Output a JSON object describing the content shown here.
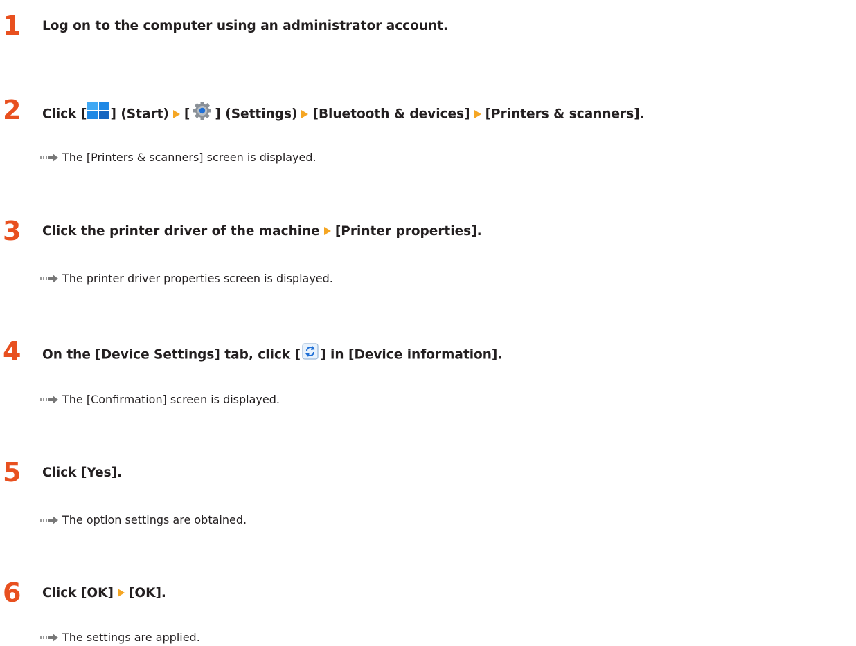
{
  "steps": [
    {
      "number": "1",
      "text": "Log on to the computer using an administrator account."
    },
    {
      "number": "2",
      "parts": {
        "click": "Click [",
        "start_close": "] (Start)",
        "settings_open": "[",
        "settings_close": "] (Settings)",
        "bluetooth": "[Bluetooth & devices]",
        "printers": "[Printers & scanners]."
      },
      "icons": [
        "windows-start-icon",
        "settings-gear-icon"
      ],
      "result": "The [Printers & scanners] screen is displayed."
    },
    {
      "number": "3",
      "parts": {
        "first": "Click the printer driver of the machine",
        "second": "[Printer properties]."
      },
      "result": "The printer driver properties screen is displayed."
    },
    {
      "number": "4",
      "parts": {
        "before": "On the [Device Settings] tab, click [",
        "after": "] in [Device information]."
      },
      "icons": [
        "refresh-icon"
      ],
      "result": "The [Confirmation] screen is displayed."
    },
    {
      "number": "5",
      "text": "Click [Yes].",
      "result": "The option settings are obtained."
    },
    {
      "number": "6",
      "parts": {
        "first": "Click [OK]",
        "second": "[OK]."
      },
      "result": "The settings are applied."
    }
  ],
  "colors": {
    "step_number": "#e8501f",
    "separator_arrow": "#f5a623",
    "result_arrow": "#777777",
    "text": "#231f20"
  }
}
